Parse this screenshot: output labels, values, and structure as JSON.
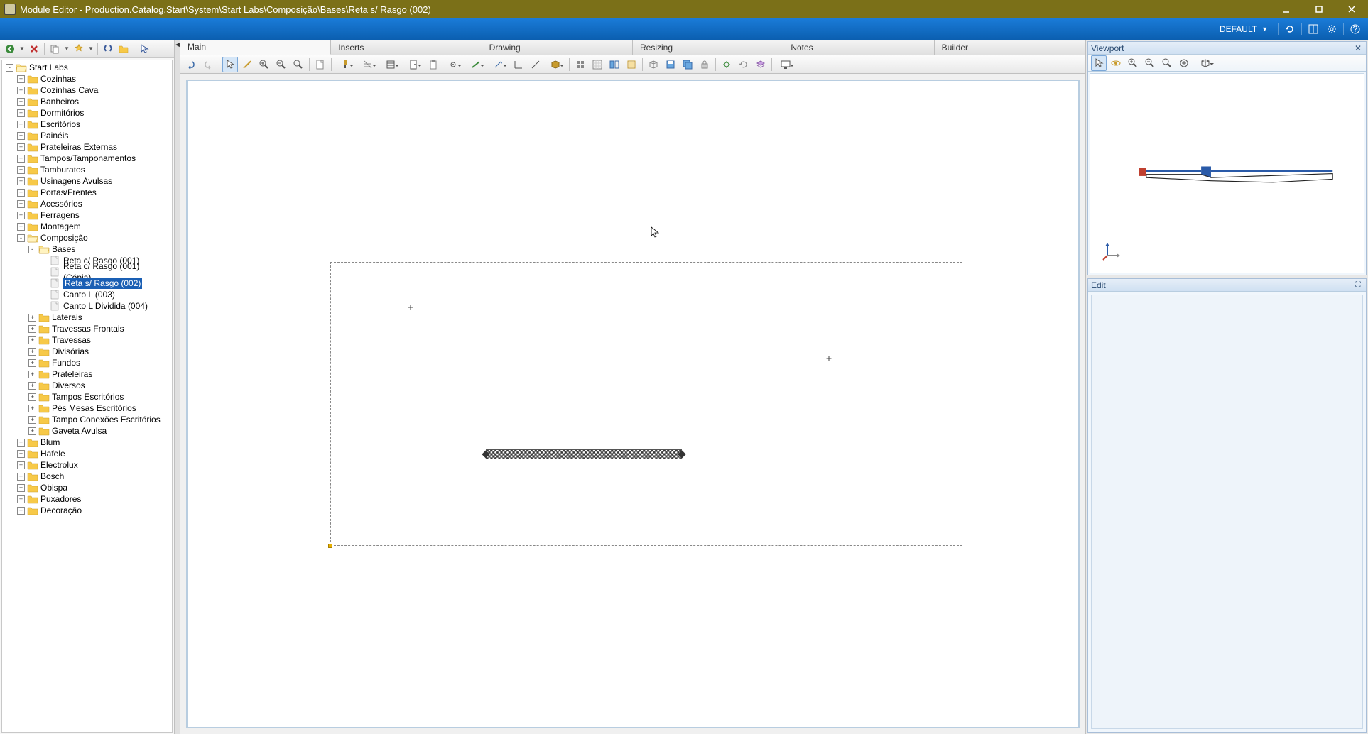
{
  "title": "Module Editor - Production.Catalog.Start\\System\\Start Labs\\Composição\\Bases\\Reta s/ Rasgo (002)",
  "ribbon": {
    "default_label": "DEFAULT"
  },
  "tabs": {
    "main": "Main",
    "inserts": "Inserts",
    "drawing": "Drawing",
    "resizing": "Resizing",
    "notes": "Notes",
    "builder": "Builder"
  },
  "panels": {
    "viewport": "Viewport",
    "edit": "Edit"
  },
  "tree": {
    "root": "Start Labs",
    "level1": [
      "Cozinhas",
      "Cozinhas Cava",
      "Banheiros",
      "Dormitórios",
      "Escritórios",
      "Painéis",
      "Prateleiras Externas",
      "Tampos/Tamponamentos",
      "Tamburatos",
      "Usinagens Avulsas",
      "Portas/Frentes",
      "Acessórios",
      "Ferragens",
      "Montagem",
      "Composição",
      "Blum",
      "Hafele",
      "Electrolux",
      "Bosch",
      "Obispa",
      "Puxadores",
      "Decoração"
    ],
    "composicao_children": [
      "Bases",
      "Laterais",
      "Travessas Frontais",
      "Travessas",
      "Divisórias",
      "Fundos",
      "Prateleiras",
      "Diversos",
      "Tampos Escritórios",
      "Pés Mesas Escritórios",
      "Tampo Conexões Escritórios",
      "Gaveta Avulsa"
    ],
    "bases_children": [
      "Reta c/ Rasgo (001)",
      "Reta c/ Rasgo (001) (Cópia)",
      "Reta s/ Rasgo (002)",
      "Canto L (003)",
      "Canto L Dividida (004)"
    ],
    "selected": "Reta s/ Rasgo (002)"
  }
}
